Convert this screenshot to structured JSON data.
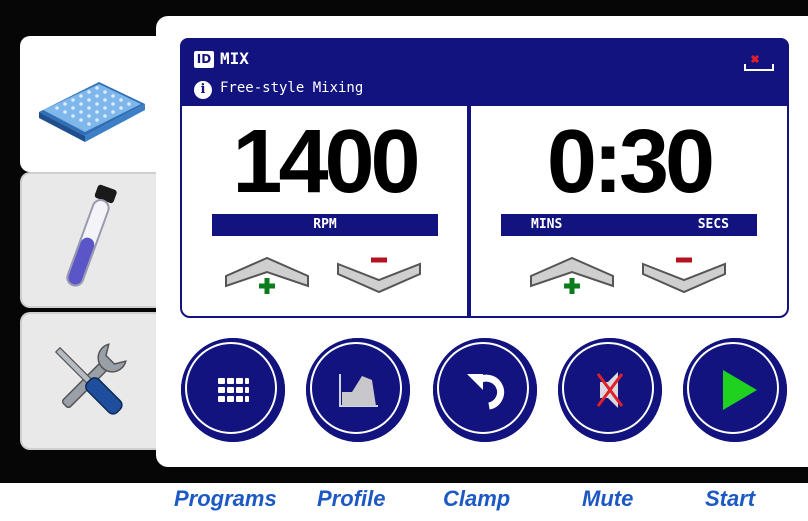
{
  "tabs": [
    {
      "name": "microplate",
      "icon": "microplate-icon",
      "selected": true
    },
    {
      "name": "tube",
      "icon": "test-tube-icon",
      "selected": false
    },
    {
      "name": "settings",
      "icon": "wrench-screwdriver-icon",
      "selected": false
    }
  ],
  "header": {
    "id_badge": "ID",
    "program_name": "MIX",
    "info_symbol": "i",
    "program_description": "Free-style Mixing"
  },
  "rpm": {
    "value": "1400",
    "label": "RPM"
  },
  "timer": {
    "value": "0:30",
    "label_minutes": "MINS",
    "label_seconds": "SECS"
  },
  "buttons": [
    {
      "name": "programs",
      "icon": "grid-icon",
      "caption": "Programs"
    },
    {
      "name": "profile",
      "icon": "profile-chart-icon",
      "caption": "Profile"
    },
    {
      "name": "clamp",
      "icon": "undo-arrow-icon",
      "caption": "Clamp"
    },
    {
      "name": "mute",
      "icon": "muted-speaker-icon",
      "caption": "Mute"
    },
    {
      "name": "start",
      "icon": "play-icon",
      "caption": "Start"
    }
  ],
  "colors": {
    "panel_blue": "#12137f",
    "caption_blue": "#1d59c4",
    "plus_green": "#0a7d1a",
    "minus_red": "#b3121e",
    "start_green": "#1fd21f"
  }
}
